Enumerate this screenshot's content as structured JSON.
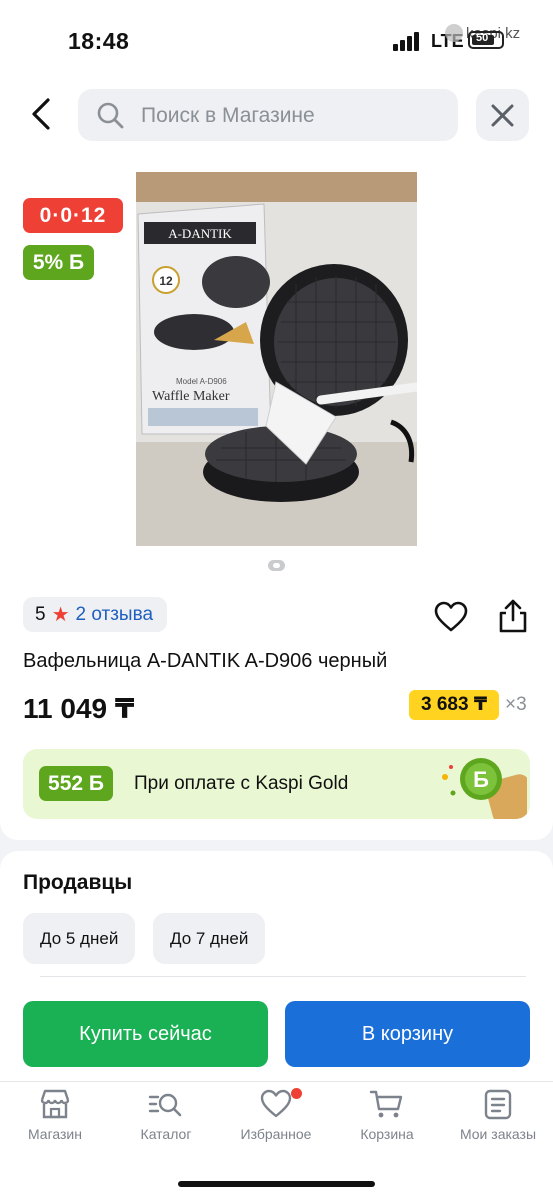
{
  "status_bar": {
    "time": "18:48",
    "network": "LTE",
    "battery": "50",
    "watermark": "kaspi.kz"
  },
  "header": {
    "search_placeholder": "Поиск в Магазине"
  },
  "product": {
    "timer_badge": "0·0·12",
    "bonus_badge": "5% Б",
    "rating": "5",
    "reviews": "2 отзыва",
    "title": "Вафельница A-DANTIK A-D906 черный",
    "price": "11 049 ₸",
    "installment": "3 683 ₸",
    "installment_multiplier": "×3",
    "gold_bonus": "552 Б",
    "gold_text": "При оплате с Kaspi Gold",
    "photo_labels": {
      "brand": "A-DANTIK",
      "model": "Model A-D906",
      "name": "Waffle Maker",
      "count": "12"
    }
  },
  "sellers": {
    "title": "Продавцы",
    "delivery_options": [
      "До 5 дней",
      "До 7 дней"
    ],
    "buy_now": "Купить сейчас",
    "add_to_cart": "В корзину"
  },
  "tabbar": {
    "items": [
      {
        "label": "Магазин",
        "icon": "shop-icon"
      },
      {
        "label": "Каталог",
        "icon": "catalog-icon"
      },
      {
        "label": "Избранное",
        "icon": "heart-icon"
      },
      {
        "label": "Корзина",
        "icon": "cart-icon"
      },
      {
        "label": "Мои заказы",
        "icon": "orders-icon"
      }
    ]
  },
  "colors": {
    "red": "#ef4035",
    "green": "#5ea61d",
    "blue": "#1a6fd9",
    "buy_green": "#1ab155",
    "yellow": "#ffd31f"
  }
}
